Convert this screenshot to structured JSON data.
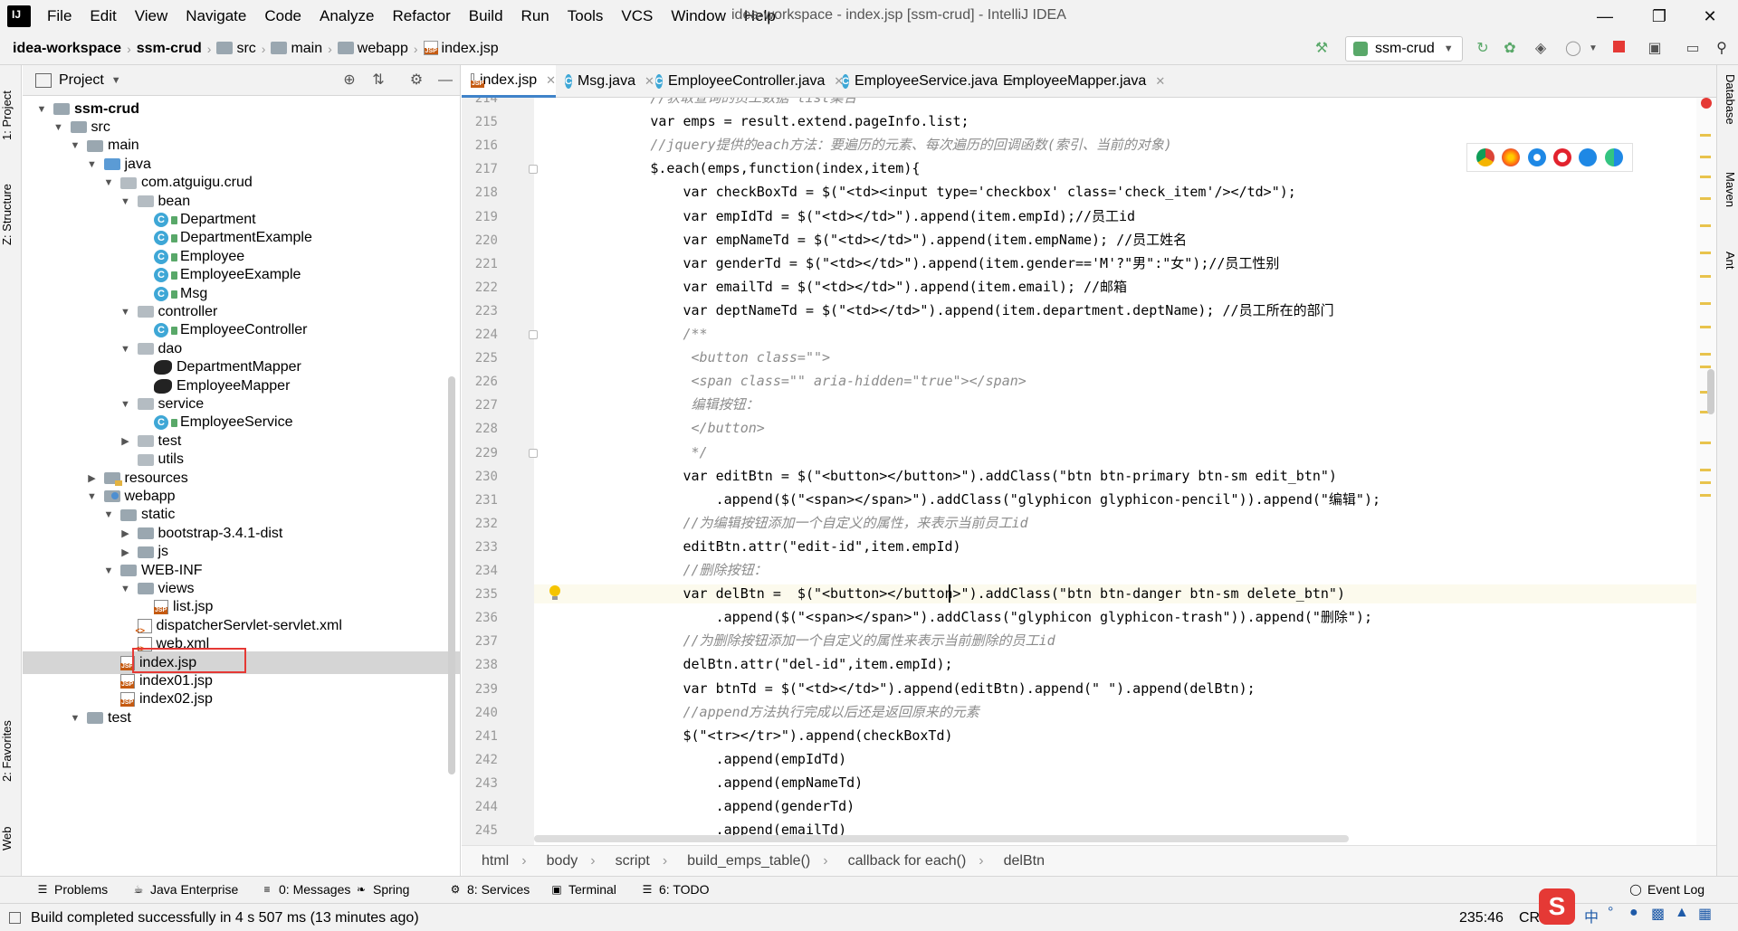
{
  "menubar": {
    "items": [
      "File",
      "Edit",
      "View",
      "Navigate",
      "Code",
      "Analyze",
      "Refactor",
      "Build",
      "Run",
      "Tools",
      "VCS",
      "Window",
      "Help"
    ],
    "window_title": "idea-workspace - index.jsp [ssm-crud] - IntelliJ IDEA",
    "logo_text": "IJ"
  },
  "navbar": {
    "crumbs": [
      "idea-workspace",
      "ssm-crud",
      "src",
      "main",
      "webapp",
      "index.jsp"
    ],
    "run_config": "ssm-crud"
  },
  "left_strip": {
    "tabs": [
      "1: Project",
      "Z: Structure",
      "2: Favorites",
      "Web"
    ]
  },
  "right_strip": {
    "tabs": [
      "Database",
      "Maven",
      "Ant"
    ]
  },
  "project": {
    "title": "Project",
    "tree": [
      {
        "label": "ssm-crud",
        "icon": "folder",
        "arrow": "open",
        "level": 0,
        "bold": true
      },
      {
        "label": "src",
        "icon": "folder",
        "arrow": "open",
        "level": 1
      },
      {
        "label": "main",
        "icon": "folder",
        "arrow": "open",
        "level": 2
      },
      {
        "label": "java",
        "icon": "folder-blue",
        "arrow": "open",
        "level": 3
      },
      {
        "label": "com.atguigu.crud",
        "icon": "package",
        "arrow": "open",
        "level": 4
      },
      {
        "label": "bean",
        "icon": "package",
        "arrow": "open",
        "level": 5
      },
      {
        "label": "Department",
        "icon": "class",
        "arrow": "",
        "level": 6
      },
      {
        "label": "DepartmentExample",
        "icon": "class",
        "arrow": "",
        "level": 6
      },
      {
        "label": "Employee",
        "icon": "class",
        "arrow": "",
        "level": 6
      },
      {
        "label": "EmployeeExample",
        "icon": "class",
        "arrow": "",
        "level": 6
      },
      {
        "label": "Msg",
        "icon": "class",
        "arrow": "",
        "level": 6
      },
      {
        "label": "controller",
        "icon": "package",
        "arrow": "open",
        "level": 5
      },
      {
        "label": "EmployeeController",
        "icon": "class",
        "arrow": "",
        "level": 6
      },
      {
        "label": "dao",
        "icon": "package",
        "arrow": "open",
        "level": 5
      },
      {
        "label": "DepartmentMapper",
        "icon": "mybatis",
        "arrow": "",
        "level": 6
      },
      {
        "label": "EmployeeMapper",
        "icon": "mybatis",
        "arrow": "",
        "level": 6
      },
      {
        "label": "service",
        "icon": "package",
        "arrow": "open",
        "level": 5
      },
      {
        "label": "EmployeeService",
        "icon": "class",
        "arrow": "",
        "level": 6
      },
      {
        "label": "test",
        "icon": "package",
        "arrow": "closed",
        "level": 5
      },
      {
        "label": "utils",
        "icon": "package",
        "arrow": "",
        "level": 5
      },
      {
        "label": "resources",
        "icon": "resources",
        "arrow": "closed",
        "level": 3
      },
      {
        "label": "webapp",
        "icon": "web",
        "arrow": "open",
        "level": 3
      },
      {
        "label": "static",
        "icon": "folder",
        "arrow": "open",
        "level": 4
      },
      {
        "label": "bootstrap-3.4.1-dist",
        "icon": "folder",
        "arrow": "closed",
        "level": 5
      },
      {
        "label": "js",
        "icon": "folder",
        "arrow": "closed",
        "level": 5
      },
      {
        "label": "WEB-INF",
        "icon": "folder",
        "arrow": "open",
        "level": 4
      },
      {
        "label": "views",
        "icon": "folder",
        "arrow": "open",
        "level": 5
      },
      {
        "label": "list.jsp",
        "icon": "jsp",
        "arrow": "",
        "level": 6
      },
      {
        "label": "dispatcherServlet-servlet.xml",
        "icon": "xml",
        "arrow": "",
        "level": 5
      },
      {
        "label": "web.xml",
        "icon": "xml",
        "arrow": "",
        "level": 5
      },
      {
        "label": "index.jsp",
        "icon": "jsp",
        "arrow": "",
        "level": 4,
        "selected": true
      },
      {
        "label": "index01.jsp",
        "icon": "jsp",
        "arrow": "",
        "level": 4
      },
      {
        "label": "index02.jsp",
        "icon": "jsp",
        "arrow": "",
        "level": 4
      },
      {
        "label": "test",
        "icon": "folder",
        "arrow": "open",
        "level": 2
      }
    ]
  },
  "tabs": [
    {
      "label": "index.jsp",
      "icon": "jsp",
      "active": true
    },
    {
      "label": "Msg.java",
      "icon": "class"
    },
    {
      "label": "EmployeeController.java",
      "icon": "class"
    },
    {
      "label": "EmployeeService.java",
      "icon": "class"
    },
    {
      "label": "EmployeeMapper.java",
      "icon": "mybatis"
    }
  ],
  "editor": {
    "first_line": 214,
    "lines": [
      {
        "n": 214,
        "t": "            //获取查询的员工数据 list集合",
        "cm": true
      },
      {
        "n": 215,
        "t": "            var emps = result.extend.pageInfo.list;"
      },
      {
        "n": 216,
        "t": "            //jquery提供的each方法：要遍历的元素、每次遍历的回调函数(索引、当前的对象)",
        "cm": true
      },
      {
        "n": 217,
        "t": "            $.each(emps,function(index,item){"
      },
      {
        "n": 218,
        "t": "                var checkBoxTd = $(\"<td><input type='checkbox' class='check_item'/></td>\");"
      },
      {
        "n": 219,
        "t": "                var empIdTd = $(\"<td></td>\").append(item.empId);//员工id"
      },
      {
        "n": 220,
        "t": "                var empNameTd = $(\"<td></td>\").append(item.empName); //员工姓名"
      },
      {
        "n": 221,
        "t": "                var genderTd = $(\"<td></td>\").append(item.gender=='M'?\"男\":\"女\");//员工性别"
      },
      {
        "n": 222,
        "t": "                var emailTd = $(\"<td></td>\").append(item.email); //邮箱"
      },
      {
        "n": 223,
        "t": "                var deptNameTd = $(\"<td></td>\").append(item.department.deptName); //员工所在的部门"
      },
      {
        "n": 224,
        "t": "                /**",
        "cm": true
      },
      {
        "n": 225,
        "t": "                 <button class=\"\">",
        "cm": true
      },
      {
        "n": 226,
        "t": "                 <span class=\"\" aria-hidden=\"true\"></span>",
        "cm": true
      },
      {
        "n": 227,
        "t": "                 编辑按钮：",
        "cm": true
      },
      {
        "n": 228,
        "t": "                 </button>",
        "cm": true
      },
      {
        "n": 229,
        "t": "                 */",
        "cm": true
      },
      {
        "n": 230,
        "t": "                var editBtn = $(\"<button></button>\").addClass(\"btn btn-primary btn-sm edit_btn\")"
      },
      {
        "n": 231,
        "t": "                    .append($(\"<span></span>\").addClass(\"glyphicon glyphicon-pencil\")).append(\"编辑\");"
      },
      {
        "n": 232,
        "t": "                //为编辑按钮添加一个自定义的属性，来表示当前员工id",
        "cm": true
      },
      {
        "n": 233,
        "t": "                editBtn.attr(\"edit-id\",item.empId)"
      },
      {
        "n": 234,
        "t": "                //删除按钮：",
        "cm": true
      },
      {
        "n": 235,
        "t": "                var delBtn =  $(\"<button></button>\").addClass(\"btn btn-danger btn-sm delete_btn\")"
      },
      {
        "n": 236,
        "t": "                    .append($(\"<span></span>\").addClass(\"glyphicon glyphicon-trash\")).append(\"删除\");"
      },
      {
        "n": 237,
        "t": "                //为删除按钮添加一个自定义的属性来表示当前删除的员工id",
        "cm": true
      },
      {
        "n": 238,
        "t": "                delBtn.attr(\"del-id\",item.empId);"
      },
      {
        "n": 239,
        "t": "                var btnTd = $(\"<td></td>\").append(editBtn).append(\" \").append(delBtn);"
      },
      {
        "n": 240,
        "t": "                //append方法执行完成以后还是返回原来的元素",
        "cm": true
      },
      {
        "n": 241,
        "t": "                $(\"<tr></tr>\").append(checkBoxTd)"
      },
      {
        "n": 242,
        "t": "                    .append(empIdTd)"
      },
      {
        "n": 243,
        "t": "                    .append(empNameTd)"
      },
      {
        "n": 244,
        "t": "                    .append(genderTd)"
      },
      {
        "n": 245,
        "t": "                    .append(emailTd)"
      }
    ]
  },
  "code_breadcrumbs": [
    "html",
    "body",
    "script",
    "build_emps_table()",
    "callback for each()",
    "delBtn"
  ],
  "tool_windows": [
    {
      "label": "Problems",
      "icon": "problems-icon"
    },
    {
      "label": "Java Enterprise",
      "icon": "java-enterprise-icon"
    },
    {
      "label": "0: Messages",
      "icon": "messages-icon"
    },
    {
      "label": "Spring",
      "icon": "spring-icon"
    },
    {
      "label": "8: Services",
      "icon": "services-icon"
    },
    {
      "label": "Terminal",
      "icon": "terminal-icon"
    },
    {
      "label": "6: TODO",
      "icon": "todo-icon"
    }
  ],
  "event_log": "Event Log",
  "status": {
    "message": "Build completed successfully in 4 s 507 ms (13 minutes ago)",
    "position": "235:46",
    "line_sep": "CRL",
    "ime_label": "中"
  },
  "colors": {
    "accent": "#4083c9",
    "selection": "#d5d5d5",
    "highlight_box": "#e53935",
    "comment": "#8c8c8c"
  }
}
